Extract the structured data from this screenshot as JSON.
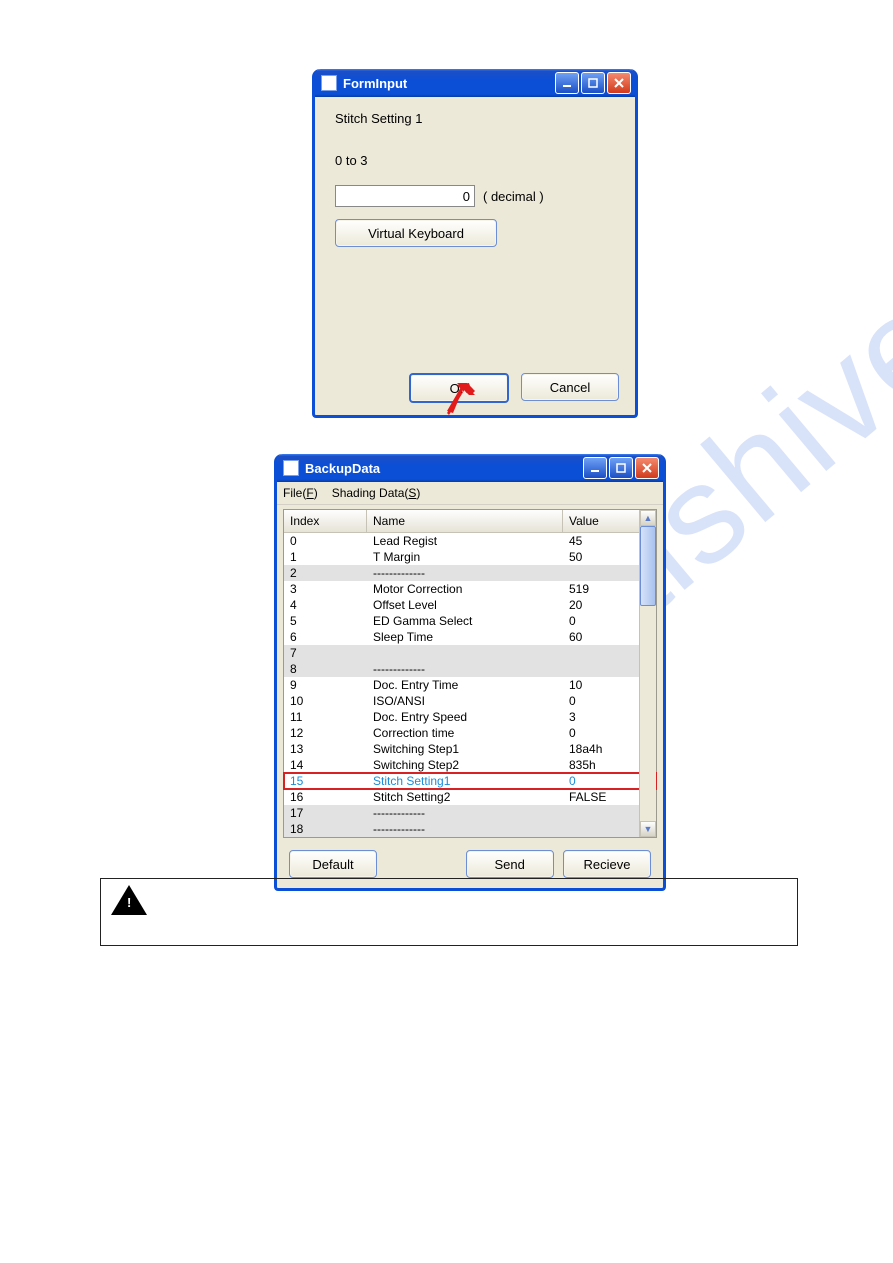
{
  "forminput": {
    "title": "FormInput",
    "label_setting": "Stitch Setting 1",
    "label_range": "0 to 3",
    "input_value": "0",
    "decimal_label": "( decimal )",
    "virtual_keyboard_label": "Virtual Keyboard",
    "ok_label": "OK",
    "cancel_label": "Cancel"
  },
  "backupdata": {
    "title": "BackupData",
    "menu_file": "File(F)",
    "menu_shading": "Shading Data(S)",
    "col_index": "Index",
    "col_name": "Name",
    "col_value": "Value",
    "rows": [
      {
        "index": "0",
        "name": "Lead Regist",
        "value": "45",
        "grey": false
      },
      {
        "index": "1",
        "name": "T Margin",
        "value": "50",
        "grey": false
      },
      {
        "index": "2",
        "name": "-------------",
        "value": "",
        "grey": true
      },
      {
        "index": "3",
        "name": "Motor Correction",
        "value": "519",
        "grey": false
      },
      {
        "index": "4",
        "name": "Offset Level",
        "value": "20",
        "grey": false
      },
      {
        "index": "5",
        "name": "ED Gamma Select",
        "value": "0",
        "grey": false
      },
      {
        "index": "6",
        "name": "Sleep Time",
        "value": "60",
        "grey": false
      },
      {
        "index": "7",
        "name": "",
        "value": "",
        "grey": true
      },
      {
        "index": "8",
        "name": "-------------",
        "value": "",
        "grey": true
      },
      {
        "index": "9",
        "name": "Doc. Entry Time",
        "value": "10",
        "grey": false
      },
      {
        "index": "10",
        "name": "ISO/ANSI",
        "value": "0",
        "grey": false
      },
      {
        "index": "11",
        "name": "Doc. Entry Speed",
        "value": "3",
        "grey": false
      },
      {
        "index": "12",
        "name": "Correction time",
        "value": "0",
        "grey": false
      },
      {
        "index": "13",
        "name": "Switching Step1",
        "value": "18a4h",
        "grey": false
      },
      {
        "index": "14",
        "name": "Switching Step2",
        "value": "835h",
        "grey": false
      },
      {
        "index": "15",
        "name": "Stitch Setting1",
        "value": "0",
        "grey": false,
        "highlight": true
      },
      {
        "index": "16",
        "name": "Stitch Setting2",
        "value": "FALSE",
        "grey": false
      },
      {
        "index": "17",
        "name": "-------------",
        "value": "",
        "grey": true
      },
      {
        "index": "18",
        "name": "-------------",
        "value": "",
        "grey": true
      }
    ],
    "default_label": "Default",
    "send_label": "Send",
    "receive_label": "Recieve"
  }
}
